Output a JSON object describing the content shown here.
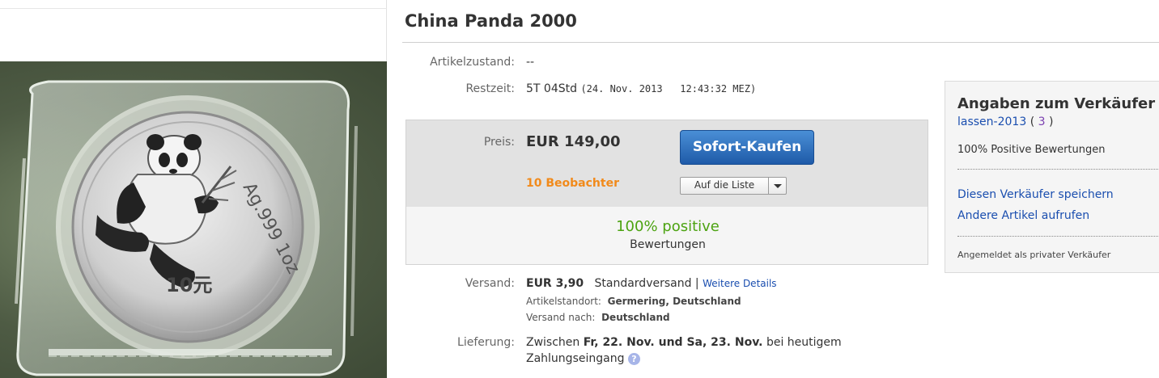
{
  "title": "China Panda 2000",
  "condition": {
    "label": "Artikelzustand:",
    "value": "--"
  },
  "time": {
    "label": "Restzeit:",
    "remaining": "5T 04Std",
    "end": "(24. Nov. 2013   12:43:32 MEZ)"
  },
  "price": {
    "label": "Preis:",
    "value": "EUR 149,00",
    "buy_button": "Sofort-Kaufen",
    "watchers": "10 Beobachter",
    "watchlist_button": "Auf die Liste"
  },
  "feedback": {
    "percent": "100% positive",
    "label": "Bewertungen"
  },
  "shipping": {
    "label": "Versand:",
    "cost": "EUR 3,90",
    "method": "Standardversand |",
    "details_link": "Weitere Details",
    "location_label": "Artikelstandort:",
    "location": "Germering, Deutschland",
    "to_label": "Versand nach:",
    "to": "Deutschland"
  },
  "delivery": {
    "label": "Lieferung:",
    "prefix": "Zwischen",
    "dates": "Fr, 22. Nov. und Sa, 23. Nov.",
    "suffix": "bei heutigem",
    "line2": "Zahlungseingang"
  },
  "seller": {
    "heading": "Angaben zum Verkäufer",
    "name": "lassen-2013",
    "open_paren": "(",
    "score": "3",
    "close_paren": ")",
    "positive": "100% Positive Bewertungen",
    "save_link": "Diesen Verkäufer speichern",
    "other_link": "Andere Artikel aufrufen",
    "note": "Angemeldet als privater Verkäufer"
  },
  "coin": {
    "inscription": "Ag.999 1oz",
    "denomination": "10元"
  },
  "colors": {
    "link": "#1a4eaf",
    "watchers": "#f18a1b",
    "positive": "#4ca311",
    "button": "#1e5aa8"
  }
}
